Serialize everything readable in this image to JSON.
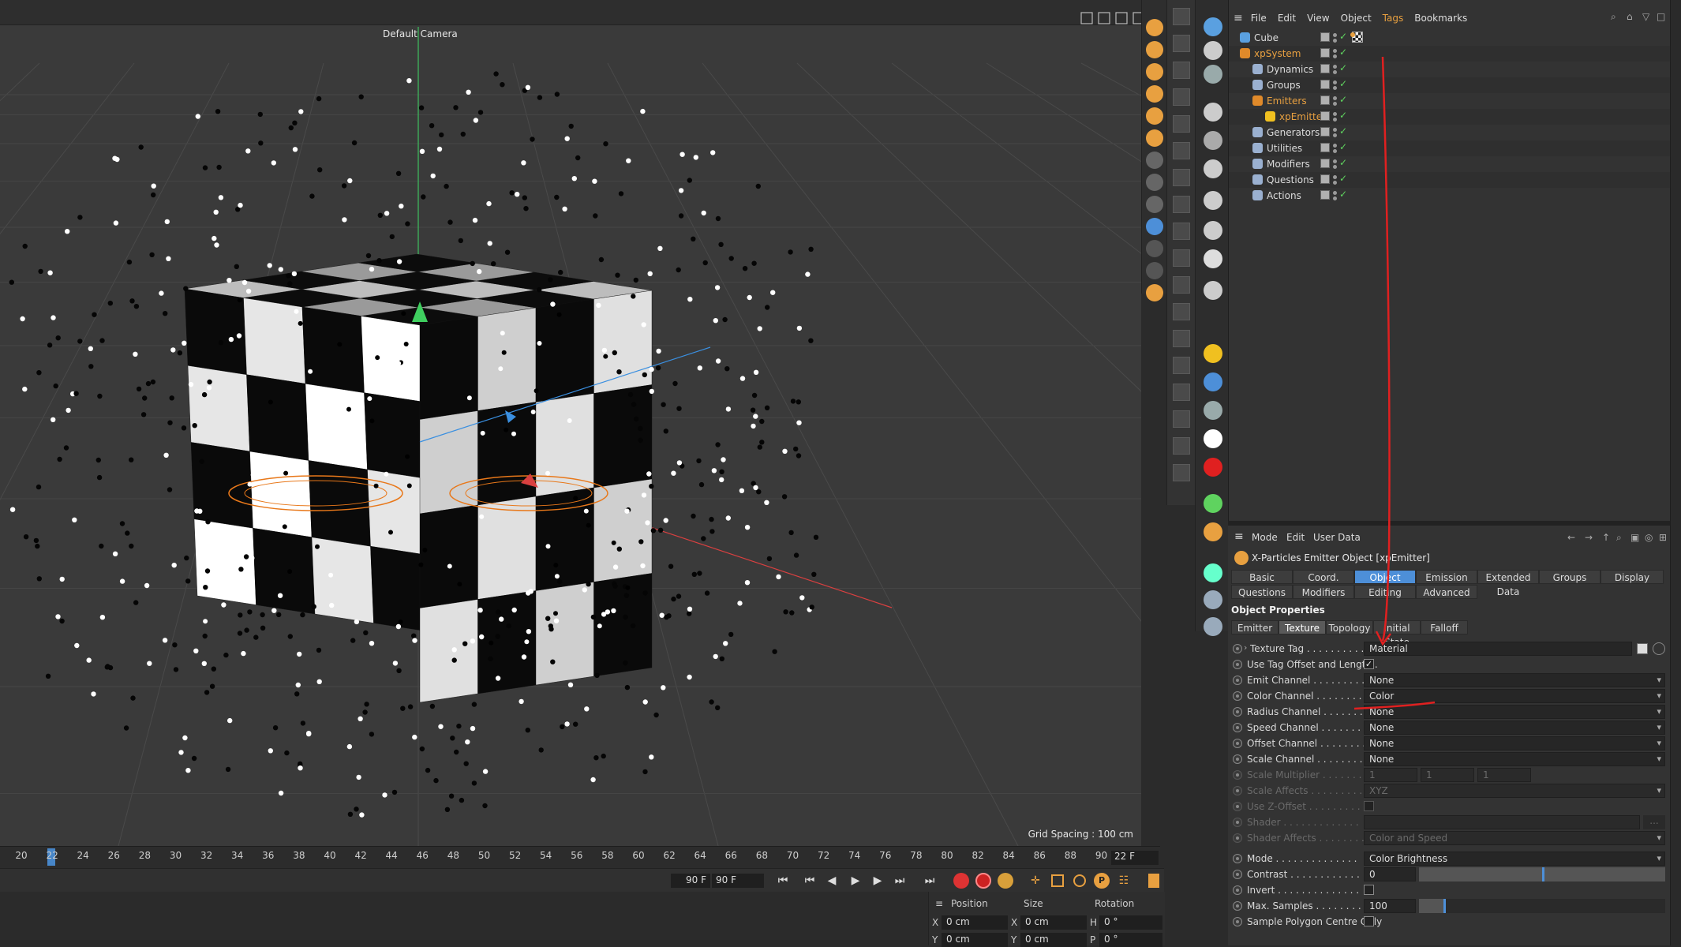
{
  "viewport": {
    "camera_label": "Default Camera",
    "grid_spacing": "Grid Spacing : 100 cm"
  },
  "timeline": {
    "ticks": [
      "20",
      "22",
      "24",
      "26",
      "28",
      "30",
      "32",
      "34",
      "36",
      "38",
      "40",
      "42",
      "44",
      "46",
      "48",
      "50",
      "52",
      "54",
      "56",
      "58",
      "60",
      "62",
      "64",
      "66",
      "68",
      "70",
      "72",
      "74",
      "76",
      "78",
      "80",
      "82",
      "84",
      "86",
      "88",
      "90"
    ],
    "current_frame": "22 F",
    "end_frame_a": "90 F",
    "end_frame_b": "90 F"
  },
  "coords": {
    "position_label": "Position",
    "size_label": "Size",
    "rotation_label": "Rotation",
    "x_label": "X",
    "y_label": "Y",
    "x2_label": "X",
    "y2_label": "Y",
    "h_label": "H",
    "p_label": "P",
    "pos_x": "0 cm",
    "pos_y": "0 cm",
    "size_x": "0 cm",
    "size_y": "0 cm",
    "rot_h": "0 °",
    "rot_p": "0 °"
  },
  "object_manager": {
    "menu": [
      "File",
      "Edit",
      "View",
      "Object",
      "Tags",
      "Bookmarks"
    ],
    "objects": [
      {
        "name": "Cube",
        "color": "#5aa0e0",
        "highlight": false
      },
      {
        "name": "xpSystem",
        "color": "#e08a2a",
        "highlight": true
      },
      {
        "name": "Dynamics",
        "color": "#9ab0d0",
        "highlight": false
      },
      {
        "name": "Groups",
        "color": "#9ab0d0",
        "highlight": false
      },
      {
        "name": "Emitters",
        "color": "#e08a2a",
        "highlight": true
      },
      {
        "name": "xpEmitter",
        "color": "#f0c020",
        "highlight": true
      },
      {
        "name": "Generators",
        "color": "#9ab0d0",
        "highlight": false
      },
      {
        "name": "Utilities",
        "color": "#9ab0d0",
        "highlight": false
      },
      {
        "name": "Modifiers",
        "color": "#9ab0d0",
        "highlight": false
      },
      {
        "name": "Questions",
        "color": "#9ab0d0",
        "highlight": false
      },
      {
        "name": "Actions",
        "color": "#9ab0d0",
        "highlight": false
      }
    ]
  },
  "attribute_manager": {
    "menu": [
      "Mode",
      "Edit",
      "User Data"
    ],
    "title": "X-Particles Emitter Object [xpEmitter]",
    "tabs_row1": [
      "Basic",
      "Coord.",
      "Object",
      "Emission",
      "Extended Data",
      "Groups",
      "Display"
    ],
    "tabs_row2": [
      "Questions",
      "Modifiers",
      "Editing",
      "Advanced"
    ],
    "active_tab": "Object",
    "section_title": "Object Properties",
    "subtabs": [
      "Emitter",
      "Texture",
      "Topology",
      "Initial State",
      "Falloff"
    ],
    "active_subtab": "Texture",
    "props": {
      "texture_tag_label": "Texture Tag . . . . . . . . . .",
      "texture_tag_value": "Material",
      "use_tag_offset_label": "Use Tag Offset and Length .",
      "emit_channel_label": "Emit Channel . . . . . . . . .",
      "emit_channel_value": "None",
      "color_channel_label": "Color Channel . . . . . . . .",
      "color_channel_value": "Color",
      "radius_channel_label": "Radius Channel . . . . . . .",
      "radius_channel_value": "None",
      "speed_channel_label": "Speed Channel . . . . . . . .",
      "speed_channel_value": "None",
      "offset_channel_label": "Offset Channel . . . . . . . .",
      "offset_channel_value": "None",
      "scale_channel_label": "Scale Channel . . . . . . . .",
      "scale_channel_value": "None",
      "scale_multiplier_label": "Scale Multiplier . . . . . . .",
      "scale_mult_x": "1",
      "scale_mult_y": "1",
      "scale_mult_z": "1",
      "scale_affects_label": "Scale Affects . . . . . . . . .",
      "scale_affects_value": "XYZ",
      "use_z_offset_label": "Use Z-Offset . . . . . . . . .",
      "shader_label": "Shader . . . . . . . . . . . . .",
      "shader_affects_label": "Shader Affects . . . . . . . .",
      "shader_affects_value": "Color and Speed",
      "mode_label": "Mode . . . . . . . . . . . . . .",
      "mode_value": "Color Brightness",
      "contrast_label": "Contrast . . . . . . . . . . . .",
      "contrast_value": "0",
      "invert_label": "Invert . . . . . . . . . . . . . .",
      "max_samples_label": "Max. Samples . . . . . . . .",
      "max_samples_value": "100",
      "sample_polygon_label": "Sample Polygon Centre Only"
    },
    "contrast_level": 0.5,
    "max_samples_level": 0.1
  },
  "colors": {
    "accent": "#4d8fd8",
    "annotation": "#e02020",
    "highlight_text": "#e8a040"
  }
}
